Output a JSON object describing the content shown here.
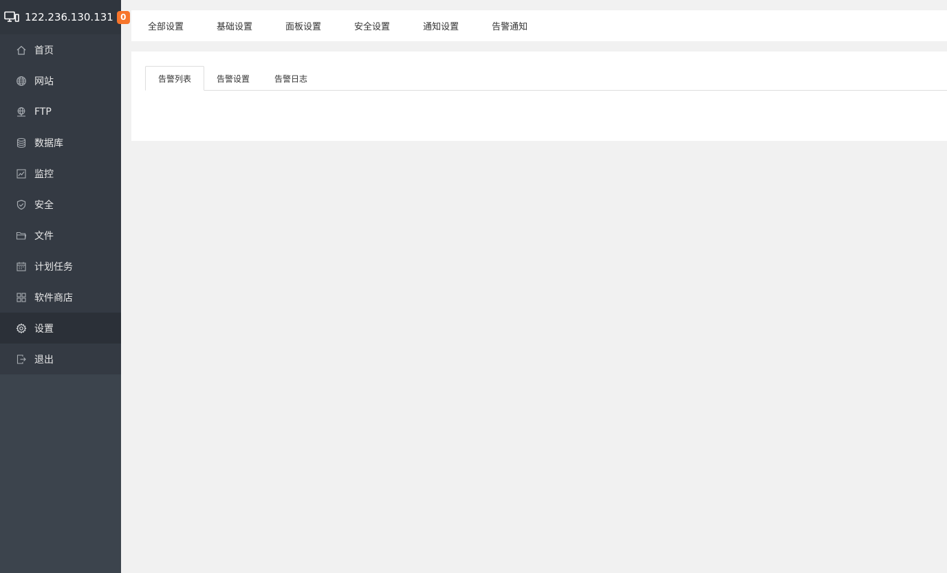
{
  "server": {
    "ip": "122.236.130.131",
    "badge_count": "0",
    "icon": "monitor-icon"
  },
  "sidebar": {
    "items": [
      {
        "label": "首页",
        "icon": "home-icon"
      },
      {
        "label": "网站",
        "icon": "globe-icon"
      },
      {
        "label": "FTP",
        "icon": "ftp-icon"
      },
      {
        "label": "数据库",
        "icon": "database-icon"
      },
      {
        "label": "监控",
        "icon": "monitor-chart-icon"
      },
      {
        "label": "安全",
        "icon": "shield-icon"
      },
      {
        "label": "文件",
        "icon": "folder-icon"
      },
      {
        "label": "计划任务",
        "icon": "calendar-icon"
      },
      {
        "label": "软件商店",
        "icon": "apps-grid-icon"
      },
      {
        "label": "设置",
        "icon": "gear-icon",
        "active": true
      },
      {
        "label": "退出",
        "icon": "logout-icon"
      }
    ]
  },
  "topbar": {
    "tabs": [
      "全部设置",
      "基础设置",
      "面板设置",
      "安全设置",
      "通知设置",
      "告警通知"
    ]
  },
  "subtabs": {
    "tabs": [
      "告警列表",
      "告警设置",
      "告警日志"
    ],
    "active_index": 0
  },
  "colors": {
    "sidebar_bg": "#3c444d",
    "sidebar_item_bg": "#343a43",
    "sidebar_active_bg": "#2b3038",
    "badge": "#f7752b",
    "page_bg": "#f1f1f1"
  }
}
